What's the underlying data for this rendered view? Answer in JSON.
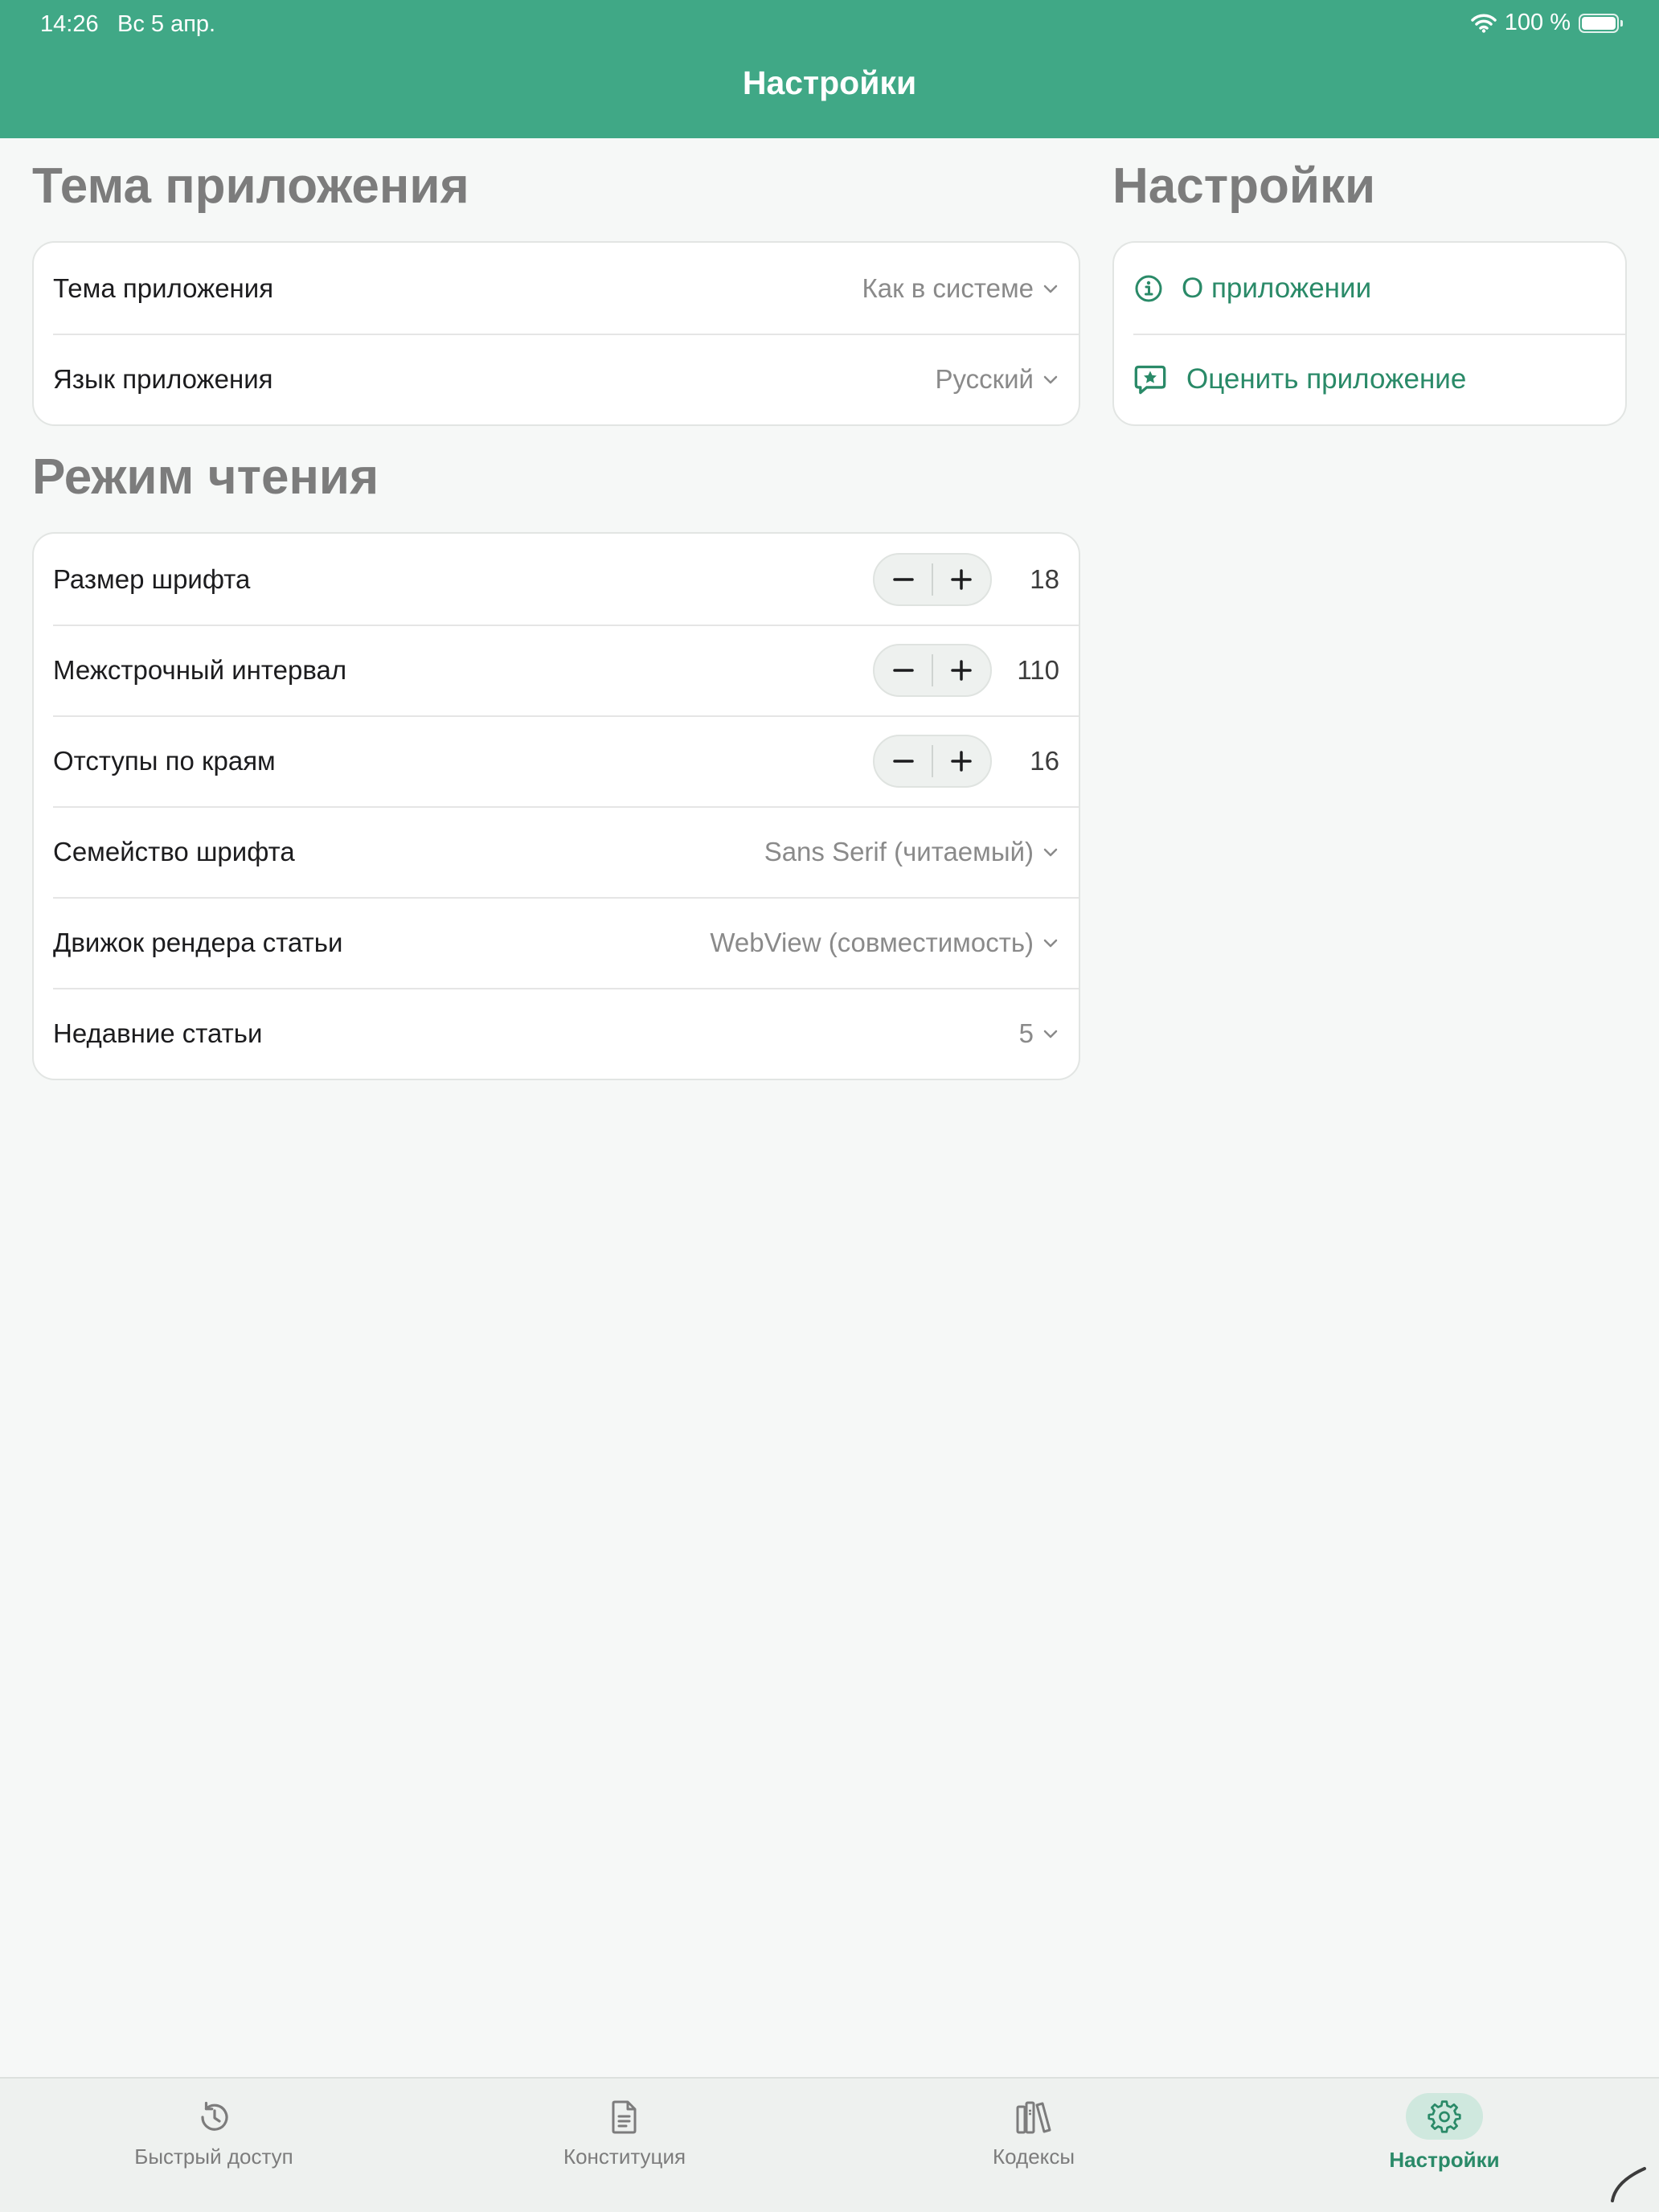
{
  "status_bar": {
    "time": "14:26",
    "date": "Вс 5 апр.",
    "battery": "100 %"
  },
  "header": {
    "title": "Настройки"
  },
  "theme_section": {
    "title": "Тема приложения",
    "rows": [
      {
        "label": "Тема приложения",
        "value": "Как в системе"
      },
      {
        "label": "Язык приложения",
        "value": "Русский"
      }
    ]
  },
  "reading_section": {
    "title": "Режим чтения",
    "steppers": [
      {
        "label": "Размер шрифта",
        "value": "18"
      },
      {
        "label": "Межстрочный интервал",
        "value": "110"
      },
      {
        "label": "Отступы по краям",
        "value": "16"
      }
    ],
    "rows": [
      {
        "label": "Семейство шрифта",
        "value": "Sans Serif (читаемый)"
      },
      {
        "label": "Движок рендера статьи",
        "value": "WebView (совместимость)"
      },
      {
        "label": "Недавние статьи",
        "value": "5"
      }
    ]
  },
  "settings_section": {
    "title": "Настройки",
    "links": [
      {
        "label": "О приложении",
        "icon": "info-icon"
      },
      {
        "label": "Оценить приложение",
        "icon": "rate-star-icon"
      }
    ]
  },
  "tabs": [
    {
      "label": "Быстрый доступ",
      "icon": "history-icon"
    },
    {
      "label": "Конституция",
      "icon": "document-icon"
    },
    {
      "label": "Кодексы",
      "icon": "books-icon"
    },
    {
      "label": "Настройки",
      "icon": "gear-icon",
      "active": true
    }
  ],
  "colors": {
    "brand": "#40a886",
    "accent": "#2a8a68",
    "background": "#f6f8f7"
  }
}
